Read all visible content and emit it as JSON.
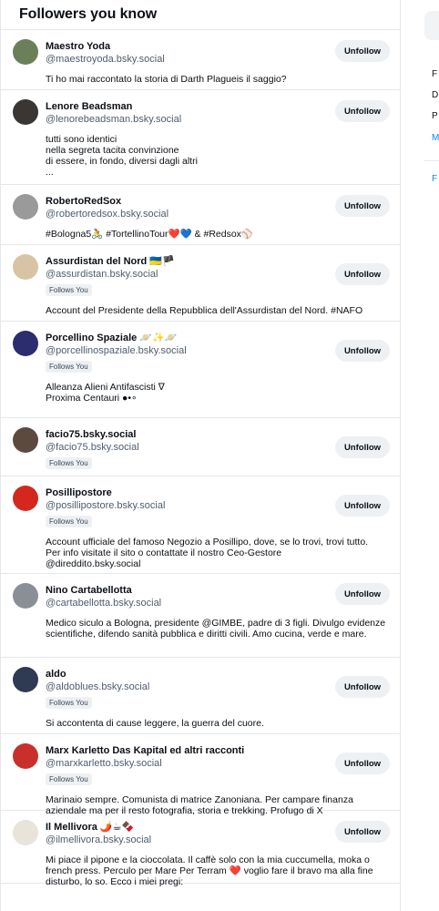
{
  "header": {
    "title": "Followers you know"
  },
  "unfollow_label": "Unfollow",
  "follows_you_label": "Follows You",
  "items": [
    {
      "name": "Maestro Yoda",
      "handle": "@maestroyoda.bsky.social",
      "follows_you": false,
      "bio": "Ti ho mai raccontato la storia di Darth Plagueis il saggio?",
      "avatar_color": "#6b7f5a",
      "avatar_text": ""
    },
    {
      "name": "Lenore Beadsman",
      "handle": "@lenorebeadsman.bsky.social",
      "follows_you": false,
      "bio": "tutti sono identici\nnella segreta tacita convinzione\ndi essere, in fondo, diversi dagli altri\n...",
      "avatar_color": "#3a3633",
      "avatar_text": ""
    },
    {
      "name": "RobertoRedSox",
      "handle": "@robertoredsox.bsky.social",
      "follows_you": false,
      "bio": "#Bologna5🚴 #TortellinoTour❤️💙 & #Redsox⚾",
      "avatar_color": "#9a9a9a",
      "avatar_text": ""
    },
    {
      "name": "Assurdistan del Nord 🇺🇦🏴",
      "handle": "@assurdistan.bsky.social",
      "follows_you": true,
      "bio": "Account del Presidente della Repubblica dell'Assurdistan del Nord. #NAFO",
      "avatar_color": "#d9c3a5",
      "avatar_text": ""
    },
    {
      "name": "Porcellino Spaziale 🪐✨🪐",
      "handle": "@porcellinospaziale.bsky.social",
      "follows_you": true,
      "bio": "Alleanza Alieni Antifascisti ∇\nProxima Centauri ●•∘",
      "avatar_color": "#2b2d6e",
      "avatar_text": ""
    },
    {
      "name": "facio75.bsky.social",
      "handle": "@facio75.bsky.social",
      "follows_you": true,
      "bio": "",
      "avatar_color": "#5c4a3e",
      "avatar_text": ""
    },
    {
      "name": "Posillipostore",
      "handle": "@posillipostore.bsky.social",
      "follows_you": true,
      "bio": "Account ufficiale del famoso Negozio a Posillipo, dove, se lo trovi, trovi tutto.\nPer info visitate il sito o contattate il nostro Ceo-Gestore\n@direddito.bsky.social",
      "avatar_color": "#d4281f",
      "avatar_text": ""
    },
    {
      "name": "Nino Cartabellotta",
      "handle": "@cartabellotta.bsky.social",
      "follows_you": false,
      "bio": "Medico siculo a Bologna, presidente @GIMBE, padre di 3 figli. Divulgo evidenze scientifiche, difendo sanità pubblica e diritti civili. Amo cucina, verde e mare.",
      "avatar_color": "#8a8f97",
      "avatar_text": ""
    },
    {
      "name": "aldo",
      "handle": "@aldoblues.bsky.social",
      "follows_you": true,
      "bio": "Si accontenta di cause leggere, la guerra del cuore.",
      "avatar_color": "#2f3b52",
      "avatar_text": ""
    },
    {
      "name": "Marx Karletto Das Kapital ed altri racconti",
      "handle": "@marxkarletto.bsky.social",
      "follows_you": true,
      "bio": "Marinaio sempre. Comunista di matrice Zanoniana. Per campare finanza aziendale ma per il resto fotografia, storia e trekking. Profugo di X",
      "avatar_color": "#c9302c",
      "avatar_text": ""
    },
    {
      "name": "Il Mellivora 🌶️☕🍫",
      "handle": "@ilmellivora.bsky.social",
      "follows_you": false,
      "bio": "Mi piace il pipone e la cioccolata. Il caffè solo con la mia cuccumella, moka o french press. Perculo per Mare Per Terram ❤️ voglio fare il bravo ma alla fine disturbo, lo so. Ecco i miei pregi:",
      "avatar_color": "#e8e4da",
      "avatar_text": ""
    }
  ],
  "right_sidebar": {
    "links": [
      "F",
      "D",
      "P",
      "M"
    ],
    "footer_link": "F"
  }
}
